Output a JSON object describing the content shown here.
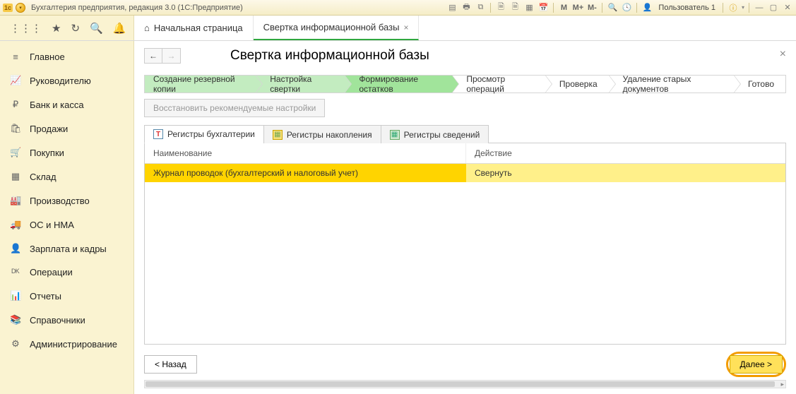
{
  "titlebar": {
    "app_title": "Бухгалтерия предприятия, редакция 3.0  (1С:Предприятие)",
    "user_label": "Пользователь 1",
    "icons": {
      "m": "M",
      "mplus": "M+",
      "mminus": "M-"
    }
  },
  "toolbar": {
    "tabs": {
      "home": "Начальная страница",
      "active": "Свертка информационной базы"
    }
  },
  "sidebar": {
    "items": [
      {
        "label": "Главное",
        "icon": "≡"
      },
      {
        "label": "Руководителю",
        "icon": "📈"
      },
      {
        "label": "Банк и касса",
        "icon": "₽"
      },
      {
        "label": "Продажи",
        "icon": "🛍"
      },
      {
        "label": "Покупки",
        "icon": "🛒"
      },
      {
        "label": "Склад",
        "icon": "▦"
      },
      {
        "label": "Производство",
        "icon": "🏭"
      },
      {
        "label": "ОС и НМА",
        "icon": "🚚"
      },
      {
        "label": "Зарплата и кадры",
        "icon": "👤"
      },
      {
        "label": "Операции",
        "icon": "ᴰᴷ"
      },
      {
        "label": "Отчеты",
        "icon": "📊"
      },
      {
        "label": "Справочники",
        "icon": "📚"
      },
      {
        "label": "Администрирование",
        "icon": "⚙"
      }
    ]
  },
  "page": {
    "title": "Свертка информационной базы",
    "crumbs": [
      "Создание резервной копии",
      "Настройка свертки",
      "Формирование остатков",
      "Просмотр операций",
      "Проверка",
      "Удаление старых документов",
      "Готово"
    ],
    "restore_btn": "Восстановить рекомендуемые настройки",
    "subtabs": {
      "accounting": "Регистры бухгалтерии",
      "accumulation": "Регистры накопления",
      "info": "Регистры сведений"
    },
    "grid": {
      "col_name": "Наименование",
      "col_action": "Действие",
      "rows": [
        {
          "name": "Журнал проводок (бухгалтерский и налоговый учет)",
          "action": "Свернуть"
        }
      ]
    },
    "back_btn": "< Назад",
    "next_btn": "Далее >"
  }
}
